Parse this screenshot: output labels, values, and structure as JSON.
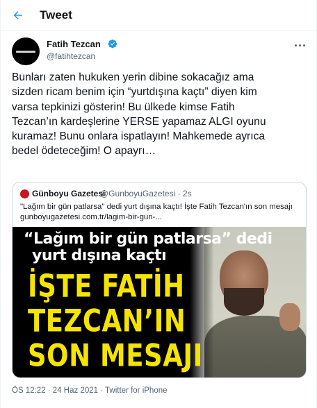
{
  "header": {
    "title": "Tweet"
  },
  "author": {
    "name": "Fatih Tezcan",
    "handle": "@fatihtezcan"
  },
  "tweet": {
    "text": "Bunları zaten hukuken yerin dibine sokacağız ama\nsizden ricam benim için “yurtdışına kaçtı” diyen kim\nvarsa tepkinizi gösterin! Bu ülkede kimse Fatih\nTezcan’ın kardeşlerine YERSE yapamaz ALGI oyunu\nkuramaz! Bunu onlara ispatlayın! Mahkemede ayrıca\nbedel ödeteceğim! O apayrı…"
  },
  "quoted": {
    "name": "Günboyu Gazetesi",
    "handle": "@GunboyuGazetesi · 2s",
    "text": "\"Lağım bir gün patlarsa\" dedi yurt dışına kaçtı! İşte Fatih Tezcan'ın son mesajı",
    "link": "gunboyugazetesi.com.tr/lagim-bir-gun-...",
    "image": {
      "line1": "“Lağım bir gün patlarsa” dedi",
      "line2": "yurt dışına kaçtı",
      "big1": "İŞTE FATİH",
      "big2": "TEZCAN’IN",
      "big3": "SON MESAJI"
    }
  },
  "meta": {
    "text": "ÖS 12:22 · 24 Haz 2021 · Twitter for iPhone"
  },
  "colors": {
    "accent": "#1d9bf0",
    "headline_yellow": "#f5e400",
    "muted": "#536471"
  },
  "icons": {
    "back": "arrow-left-icon",
    "verified": "verified-badge-icon",
    "more": "more-horizontal-icon"
  }
}
